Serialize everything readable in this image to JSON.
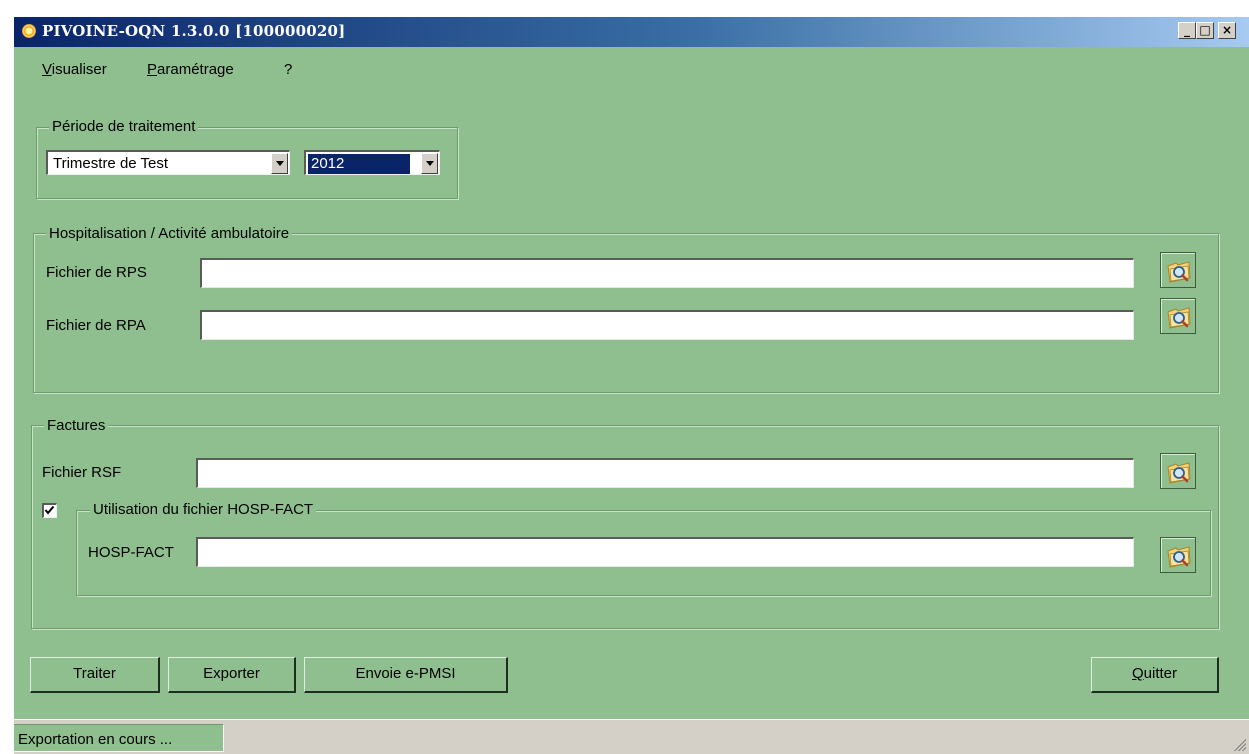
{
  "window": {
    "title": "PIVOINE-OQN 1.3.0.0 [100000020]",
    "minimize_glyph": "_",
    "maximize_glyph": "□",
    "close_glyph": "×"
  },
  "menu": {
    "items": [
      {
        "access": "V",
        "rest": "isualiser"
      },
      {
        "access": "P",
        "rest": "aramétrage"
      },
      {
        "access": "",
        "rest": "?"
      }
    ]
  },
  "periode": {
    "legend": "Période de traitement",
    "trimestre": "Trimestre de Test",
    "annee": "2012"
  },
  "hospitalisation": {
    "legend": "Hospitalisation / Activité ambulatoire",
    "rps_label": "Fichier de RPS",
    "rps_value": "",
    "rpa_label": "Fichier de RPA",
    "rpa_value": ""
  },
  "factures": {
    "legend": "Factures",
    "rsf_label": "Fichier RSF",
    "rsf_value": "",
    "hosp_fact_checked": true,
    "hosp_fact_legend": "Utilisation du fichier HOSP-FACT",
    "hosp_fact_label": "HOSP-FACT",
    "hosp_fact_value": ""
  },
  "buttons": {
    "traiter": "Traiter",
    "exporter": "Exporter",
    "envoie": "Envoie e-PMSI",
    "quitter_access": "Q",
    "quitter_rest": "uitter"
  },
  "status": {
    "text": "Exportation en cours ..."
  },
  "colors": {
    "background": "#8fbf8f",
    "titlebar_start": "#0a246a",
    "titlebar_end": "#a6caf0",
    "selection": "#0a246a"
  },
  "icons": {
    "browse": "folder-search-icon",
    "app": "pivoine-flower-icon",
    "check": "check-icon"
  }
}
